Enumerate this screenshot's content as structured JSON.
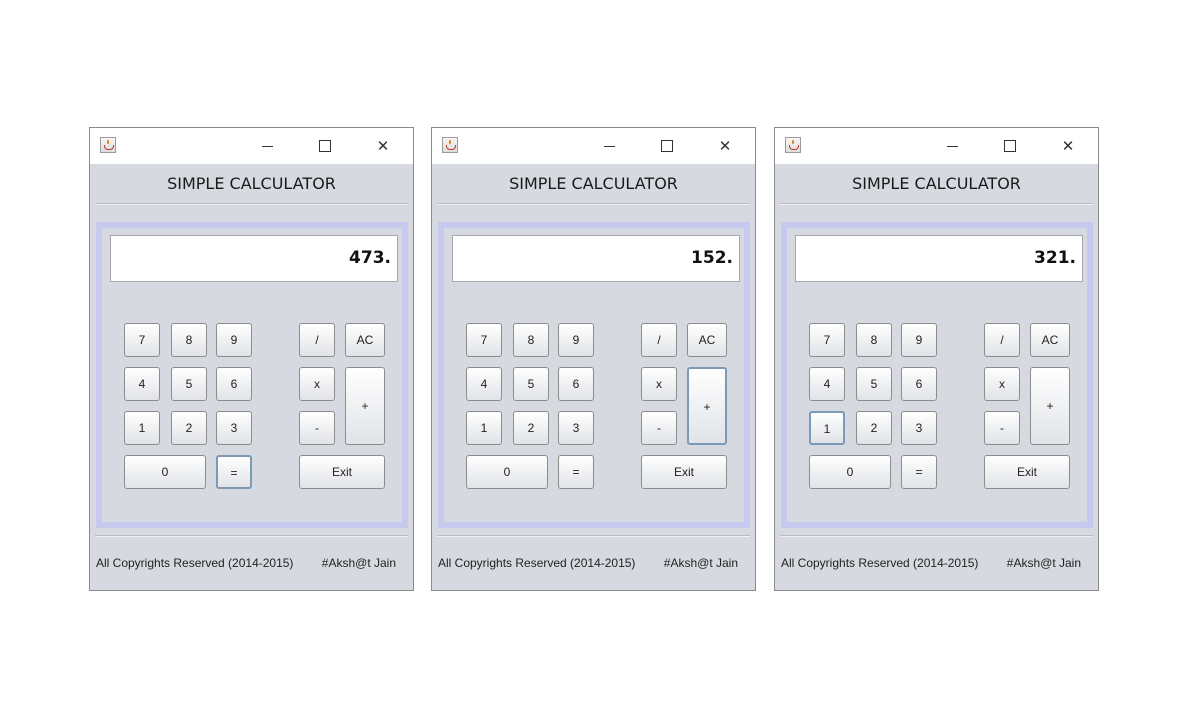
{
  "windows": [
    {
      "heading": "SIMPLE CALCULATOR",
      "display": "473.",
      "focused_key": "equals",
      "footer_left": "All Copyrights Reserved (2014-2015)",
      "footer_right": "#Aksh@t Jain"
    },
    {
      "heading": "SIMPLE CALCULATOR",
      "display": "152.",
      "focused_key": "plus",
      "footer_left": "All Copyrights Reserved (2014-2015)",
      "footer_right": "#Aksh@t Jain"
    },
    {
      "heading": "SIMPLE CALCULATOR",
      "display": "321.",
      "focused_key": "1",
      "footer_left": "All Copyrights Reserved (2014-2015)",
      "footer_right": "#Aksh@t Jain"
    }
  ],
  "keys": {
    "k7": "7",
    "k8": "8",
    "k9": "9",
    "div": "/",
    "ac": "AC",
    "k4": "4",
    "k5": "5",
    "k6": "6",
    "mul": "x",
    "plus": "+",
    "k1": "1",
    "k2": "2",
    "k3": "3",
    "minus": "-",
    "k0": "0",
    "eq": "=",
    "exit": "Exit"
  },
  "titlebar": {
    "minimize_glyph": "",
    "close_glyph": "✕"
  },
  "colors": {
    "window_bg": "#d6d9df",
    "panel_border": "#c8c9ee",
    "focus_border": "#7a9ab6"
  },
  "icons": [
    "java-cup-icon",
    "minimize-icon",
    "maximize-icon",
    "close-icon"
  ]
}
